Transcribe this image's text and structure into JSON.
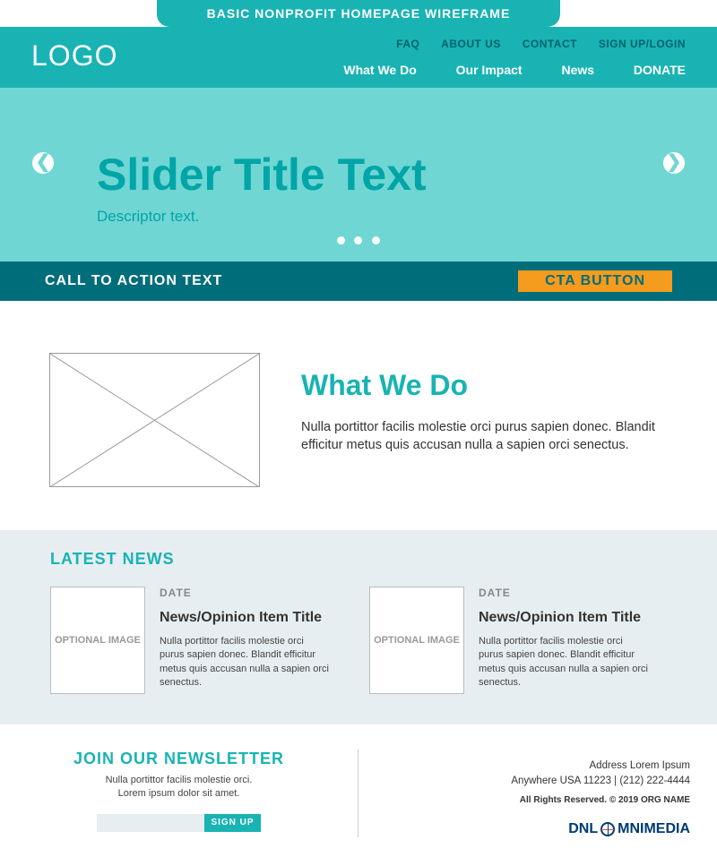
{
  "ribbon": {
    "title": "BASIC NONPROFIT HOMEPAGE WIREFRAME"
  },
  "header": {
    "logo": "LOGO",
    "utility": [
      "FAQ",
      "ABOUT US",
      "CONTACT",
      "SIGN UP/LOGIN"
    ],
    "main": [
      "What We Do",
      "Our Impact",
      "News",
      "DONATE"
    ]
  },
  "slider": {
    "title": "Slider Title Text",
    "descriptor": "Descriptor text.",
    "prev": "❮",
    "next": "❯"
  },
  "cta": {
    "text": "CALL TO ACTION TEXT",
    "button": "CTA BUTTON"
  },
  "whatWeDo": {
    "heading": "What We Do",
    "body": "Nulla portittor facilis molestie orci purus sapien donec. Blandit efficitur metus quis accusan nulla a sapien orci senectus."
  },
  "news": {
    "heading": "LATEST NEWS",
    "imagePlaceholder": "OPTIONAL IMAGE",
    "items": [
      {
        "date": "DATE",
        "title": "News/Opinion Item Title",
        "excerpt": "Nulla portittor facilis molestie orci purus sapien donec. Blandit efficitur metus quis accusan nulla a sapien orci senectus."
      },
      {
        "date": "DATE",
        "title": "News/Opinion Item Title",
        "excerpt": "Nulla portittor facilis molestie orci purus sapien donec. Blandit efficitur metus quis accusan nulla a sapien orci senectus."
      }
    ]
  },
  "newsletter": {
    "heading": "JOIN OUR NEWSLETTER",
    "line1": "Nulla portittor facilis molestie orci.",
    "line2": "Lorem ipsum dolor sit amet.",
    "signup": "SIGN UP"
  },
  "footer": {
    "address1": "Address Lorem Ipsum",
    "address2": "Anywhere USA 11223  |  (212) 222-4444",
    "rights": "All Rights Reserved. © 2019 ORG NAME",
    "dnl_left": "DNL",
    "dnl_right": "MNIMEDIA"
  }
}
